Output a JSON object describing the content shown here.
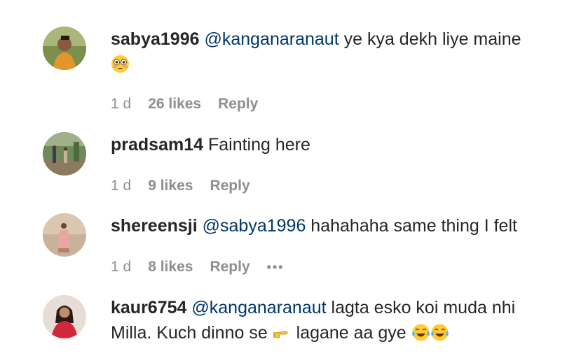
{
  "comments": [
    {
      "username": "sabya1996",
      "mention": "@kanganaranaut",
      "text": " ye kya dekh liye maine",
      "time": "1 d",
      "likes": "26 likes",
      "reply": "Reply"
    },
    {
      "username": "pradsam14",
      "text": " Fainting here",
      "time": "1 d",
      "likes": "9 likes",
      "reply": "Reply"
    },
    {
      "username": "shereensji",
      "mention": "@sabya1996",
      "text": " hahahaha same thing I felt",
      "time": "1 d",
      "likes": "8 likes",
      "reply": "Reply",
      "more": "•••"
    },
    {
      "username": "kaur6754",
      "mention": "@kanganaranaut",
      "text_line1": " lagta esko koi muda nhi",
      "text_line2a": "Milla. Kuch dinno se ",
      "text_line2b": " lagane aa gye "
    }
  ]
}
